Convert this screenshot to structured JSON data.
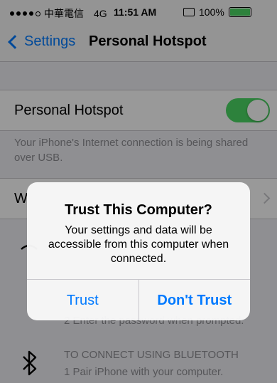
{
  "status_bar": {
    "carrier": "中華電信",
    "network": "4G",
    "time": "11:51 AM",
    "battery": "100%"
  },
  "nav": {
    "back_label": "Settings",
    "title": "Personal Hotspot"
  },
  "hotspot": {
    "label": "Personal Hotspot",
    "enabled": true,
    "footer": "Your iPhone's Internet connection is being shared over USB."
  },
  "wifi_row_label": "W",
  "instructions": {
    "usb_step2": "2 Enter the password when prompted.",
    "bluetooth_title": "TO CONNECT USING BLUETOOTH",
    "bluetooth_step1": "1 Pair iPhone with your computer."
  },
  "alert": {
    "title": "Trust This Computer?",
    "message": "Your settings and data will be accessible from this computer when connected.",
    "trust_label": "Trust",
    "dont_trust_label": "Don't Trust"
  },
  "colors": {
    "accent": "#007aff",
    "toggle_on": "#4cd964"
  }
}
